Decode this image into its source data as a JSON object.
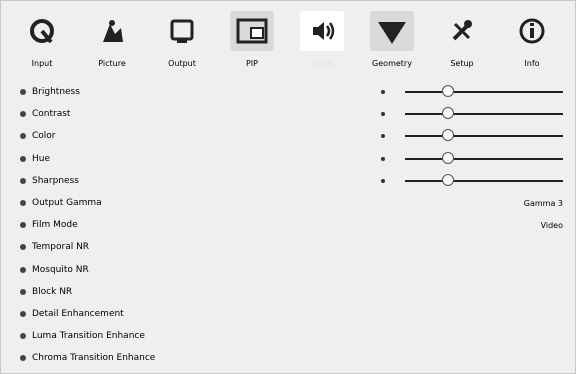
{
  "tabs": [
    {
      "label": "Input",
      "icon": "input-icon"
    },
    {
      "label": "Picture",
      "icon": "picture-icon",
      "active": true
    },
    {
      "label": "Output",
      "icon": "output-icon"
    },
    {
      "label": "PIP",
      "icon": "pip-icon"
    },
    {
      "label": "Audio",
      "icon": "audio-icon"
    },
    {
      "label": "Geometry",
      "icon": "geometry-icon"
    },
    {
      "label": "Setup",
      "icon": "setup-icon"
    },
    {
      "label": "Info",
      "icon": "info-icon"
    }
  ],
  "properties": [
    {
      "label": "Brightness",
      "type": "slider",
      "level": 0.5
    },
    {
      "label": "Contrast",
      "type": "slider",
      "level": 0.5
    },
    {
      "label": "Color",
      "type": "slider",
      "level": 0.5
    },
    {
      "label": "Hue",
      "type": "slider",
      "level": 0.5
    },
    {
      "label": "Sharpness",
      "type": "slider",
      "level": 0.5
    },
    {
      "label": "Output Gamma",
      "type": "value",
      "value": "Gamma 3"
    },
    {
      "label": "Film Mode",
      "type": "value",
      "value": "Video"
    },
    {
      "label": "Temporal NR",
      "type": "item"
    },
    {
      "label": "Mosquito NR",
      "type": "item"
    },
    {
      "label": "Block NR",
      "type": "item"
    },
    {
      "label": "Detail Enhancement",
      "type": "item"
    },
    {
      "label": "Luma Transition Enhance",
      "type": "item"
    },
    {
      "label": "Chroma Transition Enhance",
      "type": "item"
    }
  ]
}
